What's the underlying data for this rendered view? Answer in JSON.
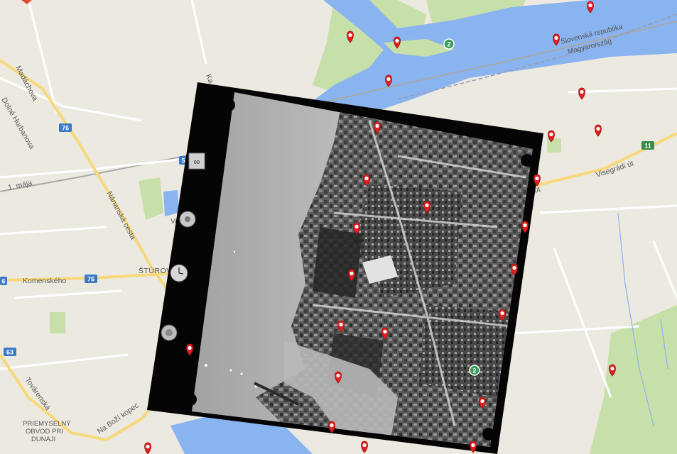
{
  "map": {
    "colors": {
      "land": "#ece9e1",
      "water": "#8ab4f0",
      "park": "#c7dfa8",
      "major_road": "#f7d97a",
      "minor_road": "#ffffff",
      "pin": "#e02020",
      "poi_green": "#3a9d5d"
    },
    "place_labels": {
      "madachova": "Madáchova",
      "dolne": "Dolné Hurbanova",
      "komenskeho": "Komenského",
      "sturovo": "ŠTÚROVO",
      "nanianska": "Nánanská cesta",
      "tovarenska": "Továrenská",
      "na_bozi": "Na Boží kopec",
      "priem1": "PRIEMYSELNÝ",
      "priem2": "OBVOD PRI",
      "priem3": "DUNAJI",
      "border1": "Slovenská republika",
      "border2": "Magyarország",
      "visegradi": "Visegrádi út",
      "ut": "út",
      "maja": "1. mája",
      "ka": "Ka",
      "va": "Va"
    },
    "road_shields": {
      "s76a": "76",
      "s76b": "76",
      "s63": "63",
      "s11": "11",
      "s5": "5",
      "s6": "6",
      "poi2a": "2",
      "poi2b": "2"
    },
    "icons": {
      "pin": "map-pin-icon",
      "poi": "poi-icon",
      "clock": "clock-icon"
    }
  },
  "photo": {
    "strip_label": "00"
  }
}
